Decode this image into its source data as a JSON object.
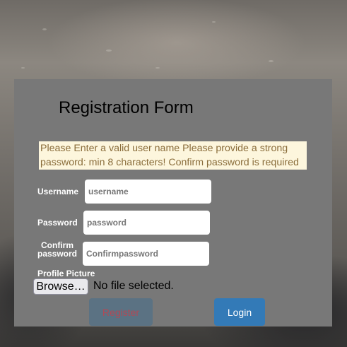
{
  "form": {
    "title": "Registration Form",
    "alert_text": "Please Enter a valid user name Please provide a strong password: min 8 characters! Confirm password is required",
    "username": {
      "label": "Username",
      "placeholder": "username",
      "value": ""
    },
    "password": {
      "label": "Password",
      "placeholder": "password",
      "value": ""
    },
    "confirm_password": {
      "label_line1": "Confirm",
      "label_line2": "password",
      "placeholder": "Confirmpassword",
      "value": ""
    },
    "profile_picture": {
      "label": "Profile Picture",
      "browse_label": "Browse…",
      "status": "No file selected."
    },
    "register_button": "Register",
    "login_button": "Login"
  },
  "colors": {
    "panel": "#787878",
    "alert_background": "#fdf6dd",
    "alert_text": "#8a6d3b",
    "login_button": "#337ab7",
    "register_button": "#5b7283",
    "register_text": "#b04a56"
  }
}
